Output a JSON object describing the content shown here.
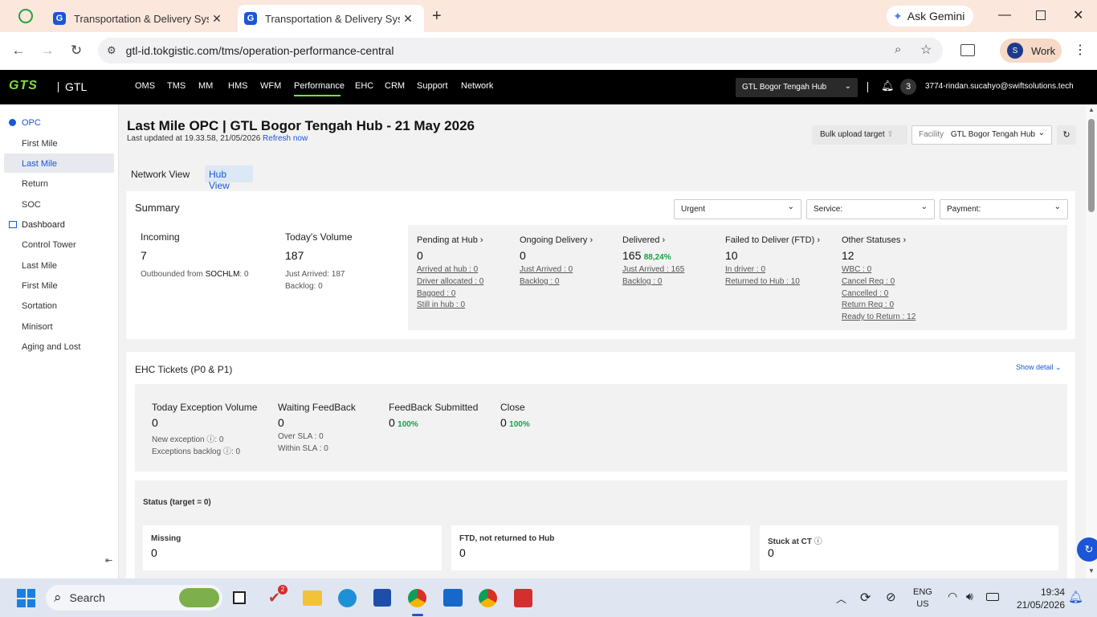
{
  "browser": {
    "tabs": [
      {
        "title": "Transportation & Delivery Syste",
        "favicon": "G"
      },
      {
        "title": "Transportation & Delivery Syste",
        "favicon": "G"
      }
    ],
    "ask_gemini": "Ask Gemini",
    "url": "gtl-id.tokgistic.com/tms/operation-performance-central",
    "profile_initial": "S",
    "profile_label": "Work"
  },
  "app": {
    "logo": "GTS",
    "brand": "GTL",
    "nav": [
      "OMS",
      "TMS",
      "MM",
      "HMS",
      "WFM",
      "Performance",
      "EHC",
      "CRM",
      "Support",
      "Network"
    ],
    "hub_select": "GTL Bogor Tengah Hub",
    "notif_count": "3",
    "user": "3774-rindan.sucahyo@swiftsolutions.tech"
  },
  "sidebar": {
    "opc": "OPC",
    "opc_items": [
      "First Mile",
      "Last Mile",
      "Return",
      "SOC"
    ],
    "dashboard": "Dashboard",
    "dashboard_items": [
      "Control Tower",
      "Last Mile",
      "First Mile",
      "Sortation",
      "Minisort",
      "Aging and Lost"
    ]
  },
  "page": {
    "title": "Last Mile OPC | GTL Bogor Tengah Hub - 21 May 2026",
    "updated": "Last updated at 19.33.58, 21/05/2026",
    "refresh": "Refresh now",
    "bulk_upload": "Bulk upload target",
    "facility_label": "Facility",
    "facility_value": "GTL Bogor Tengah Hub",
    "views": [
      "Network View",
      "Hub View"
    ]
  },
  "summary": {
    "title": "Summary",
    "filters": [
      "Urgent",
      "Service:",
      "Payment:"
    ],
    "incoming_label": "Incoming",
    "incoming_value": "7",
    "outbounded_prefix": "Outbounded from",
    "outbounded_hub": "SOCHLM",
    "outbounded_value": ": 0",
    "today_label": "Today's Volume",
    "today_value": "187",
    "just_arrived": "Just Arrived: 187",
    "backlog": "Backlog: 0",
    "pending": {
      "label": "Pending at Hub",
      "value": "0",
      "items": [
        "Arrived at hub : 0",
        "Driver allocated : 0",
        "Bagged : 0",
        "Still in hub : 0"
      ]
    },
    "ongoing": {
      "label": "Ongoing Delivery",
      "value": "0",
      "items": [
        "Just Arrived : 0",
        "Backlog : 0"
      ]
    },
    "delivered": {
      "label": "Delivered",
      "value": "165",
      "pct": "88,24%",
      "items": [
        "Just Arrived : 165",
        "Backlog : 0"
      ]
    },
    "ftd": {
      "label": "Failed to Deliver (FTD)",
      "value": "10",
      "items": [
        "In driver : 0",
        "Returned to Hub : 10"
      ]
    },
    "other": {
      "label": "Other Statuses",
      "value": "12",
      "items": [
        "WBC : 0",
        "Cancel Req : 0",
        "Cancelled : 0",
        "Return Req : 0",
        "Ready to Return : 12"
      ]
    }
  },
  "ehc": {
    "title": "EHC Tickets (P0 & P1)",
    "show_detail": "Show detail",
    "today_label": "Today Exception Volume",
    "today_value": "0",
    "new_exception": "New exception",
    "new_exception_val": ": 0",
    "exc_backlog": "Exceptions backlog",
    "exc_backlog_val": ": 0",
    "waiting_label": "Waiting FeedBack",
    "waiting_value": "0",
    "over_sla": "Over SLA : 0",
    "within_sla": "Within SLA : 0",
    "submitted_label": "FeedBack Submitted",
    "submitted_value": "0",
    "submitted_pct": "100%",
    "close_label": "Close",
    "close_value": "0",
    "close_pct": "100%"
  },
  "status": {
    "title": "Status (target = 0)",
    "cards": [
      {
        "label": "Missing",
        "value": "0"
      },
      {
        "label": "FTD, not returned to Hub",
        "value": "0"
      },
      {
        "label": "Stuck at CT",
        "value": "0"
      }
    ]
  },
  "taskbar": {
    "search": "Search",
    "lang1": "ENG",
    "lang2": "US",
    "time": "19:34",
    "date": "21/05/2026",
    "badge_todo": "2"
  }
}
